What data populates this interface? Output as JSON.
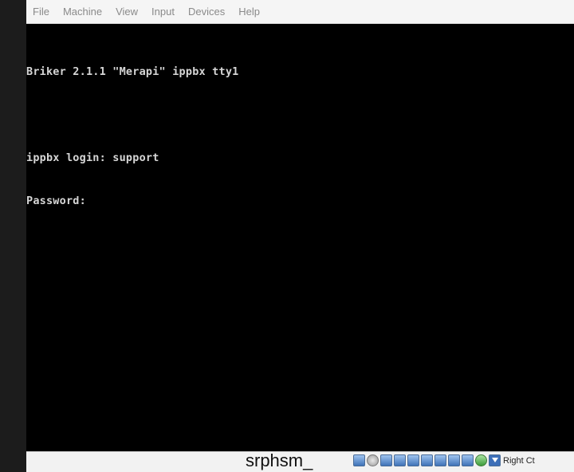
{
  "menu": {
    "items": [
      "File",
      "Machine",
      "View",
      "Input",
      "Devices",
      "Help"
    ]
  },
  "console": {
    "lines": [
      "Briker 2.1.1 \"Merapi\" ippbx tty1",
      "",
      "ippbx login: support",
      "Password:"
    ]
  },
  "statusbar": {
    "caption": "srphsm_",
    "host_key": "Right Ct",
    "icons": [
      "hard-disk-icon",
      "optical-drive-icon",
      "usb-icon",
      "network-icon",
      "shared-folders-icon",
      "display-icon",
      "video-capture-icon",
      "recording-icon",
      "clipboard-icon",
      "cpu-icon",
      "mouse-integration-icon",
      "host-key-arrow-icon"
    ]
  },
  "colors": {
    "screen_bg": "#000000",
    "console_text": "#d6d6d6",
    "menubar_bg": "#f5f5f5",
    "menu_text": "#8a8a8a"
  }
}
